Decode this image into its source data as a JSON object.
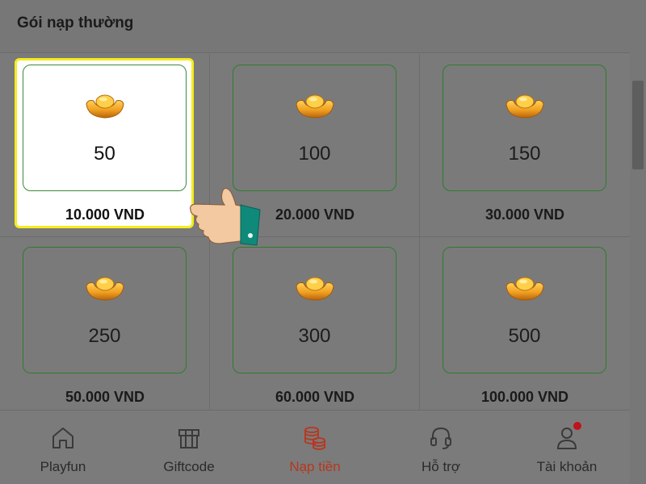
{
  "header": {
    "title": "Gói nạp thường"
  },
  "packages": [
    {
      "amount": "50",
      "price": "10.000 VND",
      "selected": true
    },
    {
      "amount": "100",
      "price": "20.000 VND",
      "selected": false
    },
    {
      "amount": "150",
      "price": "30.000 VND",
      "selected": false
    },
    {
      "amount": "250",
      "price": "50.000 VND",
      "selected": false
    },
    {
      "amount": "300",
      "price": "60.000 VND",
      "selected": false
    },
    {
      "amount": "500",
      "price": "100.000 VND",
      "selected": false
    }
  ],
  "package_icon": "gold-ingot-icon",
  "nav": {
    "items": [
      {
        "label": "Playfun",
        "icon": "home-icon",
        "active": false
      },
      {
        "label": "Giftcode",
        "icon": "gift-box-icon",
        "active": false
      },
      {
        "label": "Nạp tiền",
        "icon": "coin-stack-icon",
        "active": true
      },
      {
        "label": "Hỗ trợ",
        "icon": "headset-icon",
        "active": false
      },
      {
        "label": "Tài khoản",
        "icon": "user-icon",
        "active": false,
        "notification": true
      }
    ]
  },
  "colors": {
    "accent": "#b8361f",
    "highlight": "#f5ec1d",
    "card_border": "#2e7d2e",
    "notification": "#c0131b"
  }
}
